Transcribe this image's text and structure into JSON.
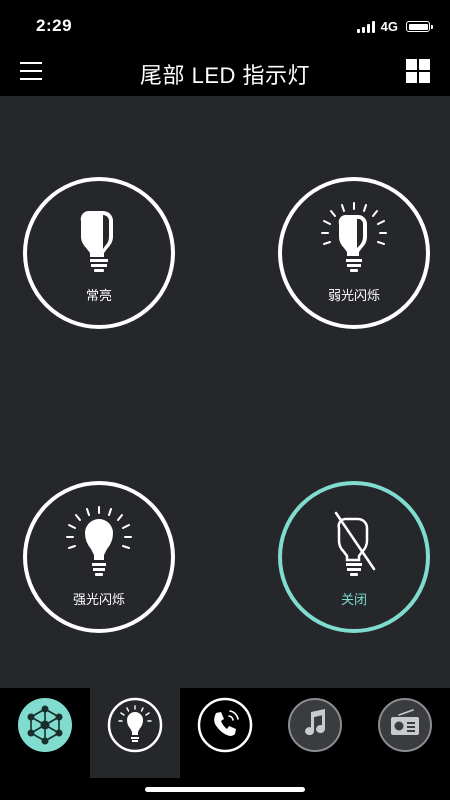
{
  "status_bar": {
    "time": "2:29",
    "network": "4G"
  },
  "header": {
    "title": "尾部 LED 指示灯"
  },
  "modes": [
    {
      "label": "常亮",
      "icon": "half-bulb-icon",
      "active": false
    },
    {
      "label": "弱光闪烁",
      "icon": "half-bulb-rays-icon",
      "active": false
    },
    {
      "label": "强光闪烁",
      "icon": "bulb-rays-icon",
      "active": false
    },
    {
      "label": "关闭",
      "icon": "bulb-off-icon",
      "active": true
    }
  ],
  "bottom_tabs": [
    {
      "name": "network-icon",
      "selected": false
    },
    {
      "name": "bulb-icon",
      "selected": true
    },
    {
      "name": "phone-icon",
      "selected": false
    },
    {
      "name": "music-icon",
      "selected": false
    },
    {
      "name": "radio-icon",
      "selected": false
    }
  ],
  "colors": {
    "accent": "#7fdccf",
    "background": "#25272b",
    "bar": "#000000"
  }
}
